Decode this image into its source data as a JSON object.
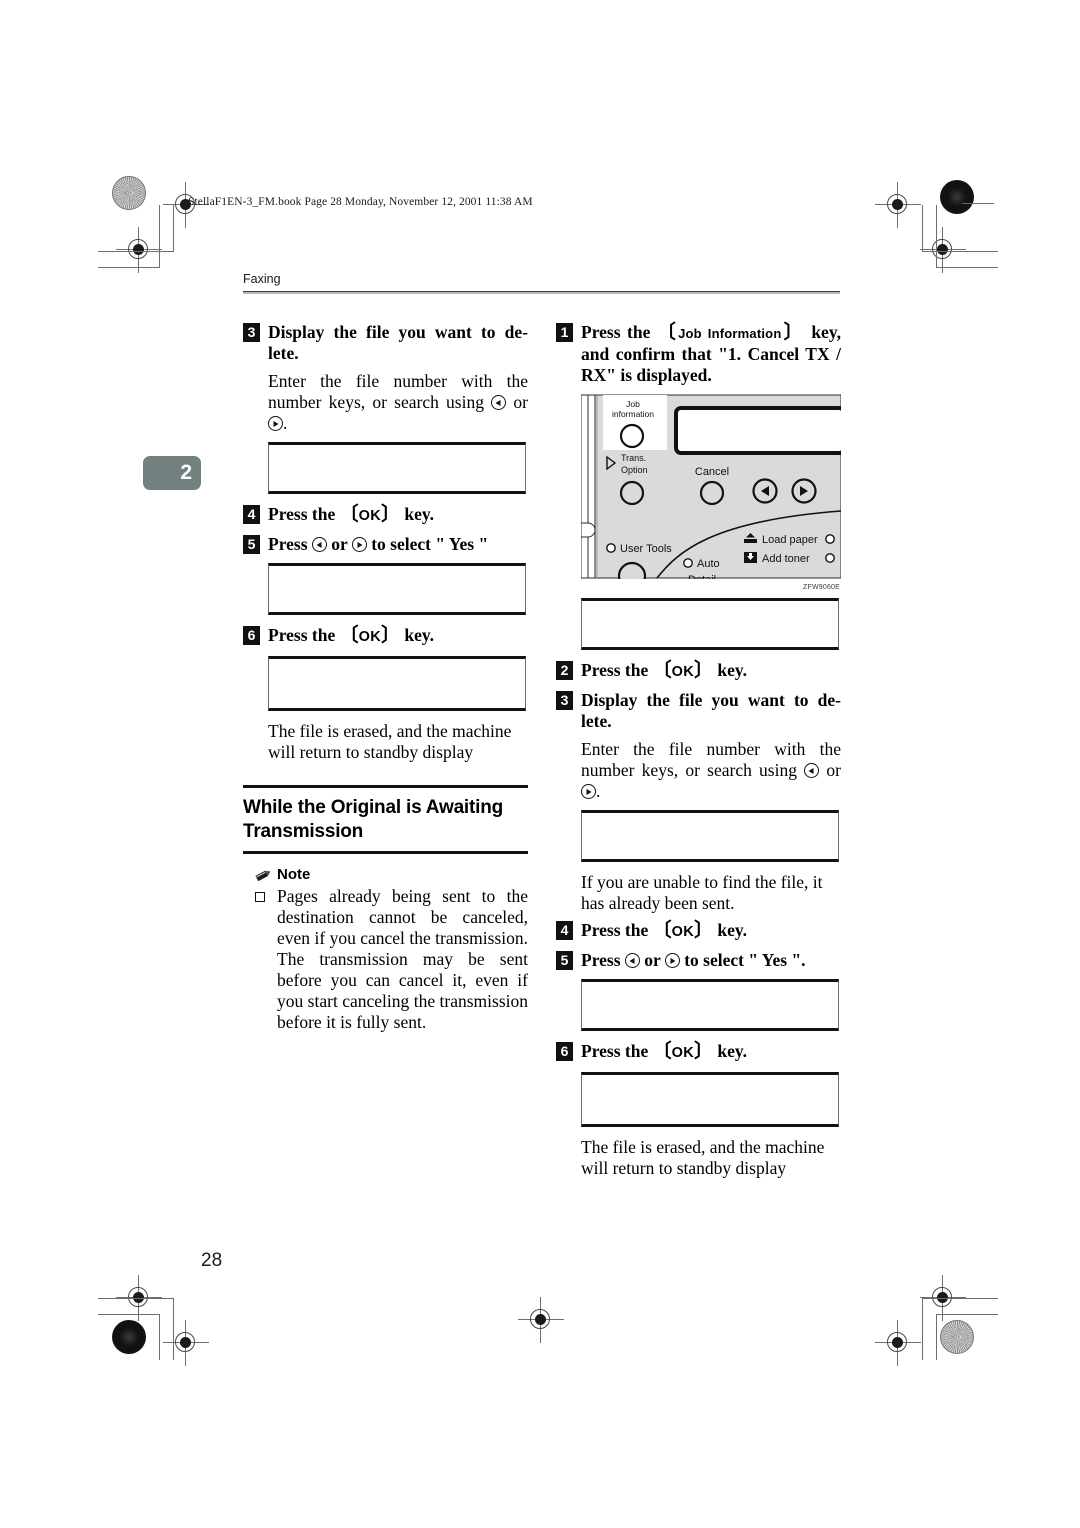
{
  "page": {
    "file_header": "StellaF1EN-3_FM.book  Page 28  Monday, November 12, 2001  11:38 AM",
    "running_head": "Faxing",
    "chapter_tab": "2",
    "folio": "28"
  },
  "left_column": {
    "step3": {
      "num": "3",
      "title": "Display the file you want to de-lete.",
      "body_1": "Enter the file number with the number keys, or search using ",
      "body_or": " or ",
      "body_2": "."
    },
    "step4": {
      "num": "4",
      "pre": "Press the ",
      "key": "OK",
      "post": " key."
    },
    "step5": {
      "num": "5",
      "pre": "Press ",
      "mid": " or ",
      "post": " to select \" Yes \""
    },
    "step6": {
      "num": "6",
      "pre": "Press the ",
      "key": "OK",
      "post": " key."
    },
    "result": "The file is erased, and the machine will return to standby display",
    "section_heading": "While the Original is Awaiting Transmission",
    "note_label": "Note",
    "note_items": [
      "Pages already being sent to the destination cannot be canceled, even if you cancel the transmission. The transmission may be sent before you can cancel it, even if you start canceling the transmission before it is fully sent."
    ]
  },
  "right_column": {
    "step1": {
      "num": "1",
      "pre": "Press the ",
      "key": "Job Information",
      "post": " key, and confirm that \"1. Cancel TX / RX\" is displayed."
    },
    "step2": {
      "num": "2",
      "pre": "Press the ",
      "key": "OK",
      "post": " key."
    },
    "step3": {
      "num": "3",
      "title": "Display the file you want to de-lete.",
      "body_1": "Enter the file number with the number keys, or search using ",
      "body_or": " or ",
      "body_2": "."
    },
    "note_after_box": "If you are unable to find the file, it has already been sent.",
    "step4": {
      "num": "4",
      "pre": "Press the ",
      "key": "OK",
      "post": " key."
    },
    "step5": {
      "num": "5",
      "pre": "Press ",
      "mid": " or ",
      "post": " to select \" Yes \"."
    },
    "step6": {
      "num": "6",
      "pre": "Press the ",
      "key": "OK",
      "post": " key."
    },
    "result": "The file is erased, and the machine will return to standby display"
  },
  "control_panel_figure": {
    "figure_code": "ZFW9060E",
    "labels": {
      "job_information": "Job\ninformation",
      "job_information_line1": "Job",
      "job_information_line2": "information",
      "trans_option_line1": "Trans.",
      "trans_option_line2": "Option",
      "cancel": "Cancel",
      "user_tools": "User Tools",
      "auto": "Auto",
      "load_paper": "Load paper",
      "add_toner": "Add toner"
    }
  }
}
